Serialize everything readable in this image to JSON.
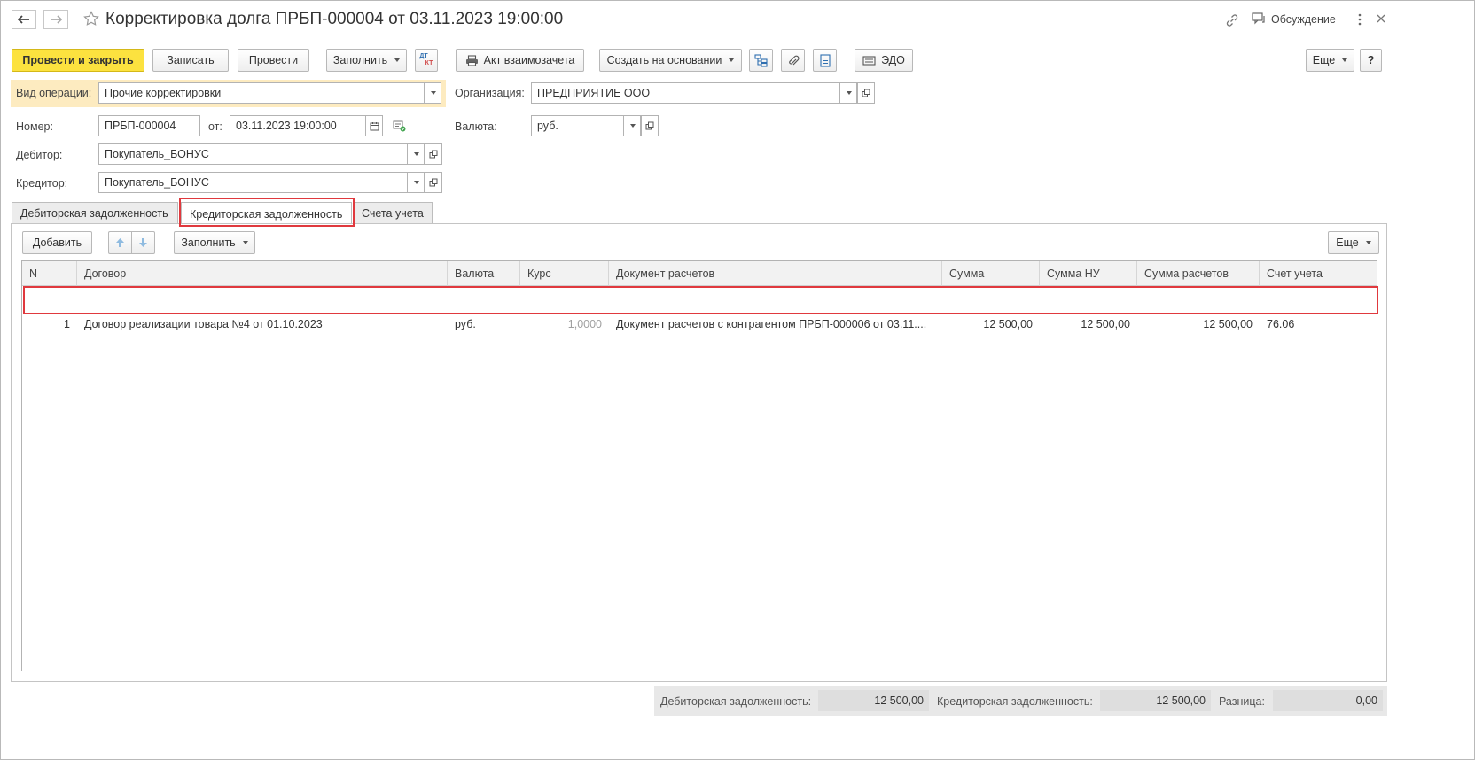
{
  "window": {
    "title": "Корректировка долга ПРБП-000004 от 03.11.2023 19:00:00",
    "discussion_label": "Обсуждение"
  },
  "toolbar": {
    "post_close": "Провести и закрыть",
    "save": "Записать",
    "post": "Провести",
    "fill": "Заполнить",
    "dtkt_top": "ДТ",
    "dtkt_bottom": "КТ",
    "act": "Акт взаимозачета",
    "create_based": "Создать на основании",
    "edo": "ЭДО",
    "more": "Еще",
    "help": "?"
  },
  "form": {
    "operation_label": "Вид операции:",
    "operation_value": "Прочие корректировки",
    "number_label": "Номер:",
    "number_value": "ПРБП-000004",
    "date_label": "от:",
    "date_value": "03.11.2023 19:00:00",
    "debtor_label": "Дебитор:",
    "debtor_value": "Покупатель_БОНУС",
    "creditor_label": "Кредитор:",
    "creditor_value": "Покупатель_БОНУС",
    "org_label": "Организация:",
    "org_value": "ПРЕДПРИЯТИЕ ООО",
    "currency_label": "Валюта:",
    "currency_value": "руб."
  },
  "tabs": [
    {
      "label": "Дебиторская задолженность",
      "active": false
    },
    {
      "label": "Кредиторская задолженность",
      "active": true
    },
    {
      "label": "Счета учета",
      "active": false
    }
  ],
  "table_toolbar": {
    "add": "Добавить",
    "fill": "Заполнить",
    "more": "Еще"
  },
  "table": {
    "columns": [
      "N",
      "Договор",
      "Валюта",
      "Курс",
      "Документ расчетов",
      "Сумма",
      "Сумма НУ",
      "Сумма расчетов",
      "Счет учета"
    ],
    "rows": [
      {
        "n": "1",
        "contract": "Договор реализации товара №4 от 01.10.2023",
        "currency": "руб.",
        "rate": "1,0000",
        "doc": "Документ расчетов с контрагентом ПРБП-000006 от 03.11....",
        "sum": "12 500,00",
        "sum_nu": "12 500,00",
        "sum_calc": "12 500,00",
        "account": "76.06"
      }
    ]
  },
  "footer": {
    "debit_label": "Дебиторская задолженность:",
    "debit_value": "12 500,00",
    "credit_label": "Кредиторская задолженность:",
    "credit_value": "12 500,00",
    "diff_label": "Разница:",
    "diff_value": "0,00"
  },
  "colors": {
    "primary_button": "#fce23f",
    "highlight": "#fdebc0",
    "annotation_red": "#e0393e"
  }
}
